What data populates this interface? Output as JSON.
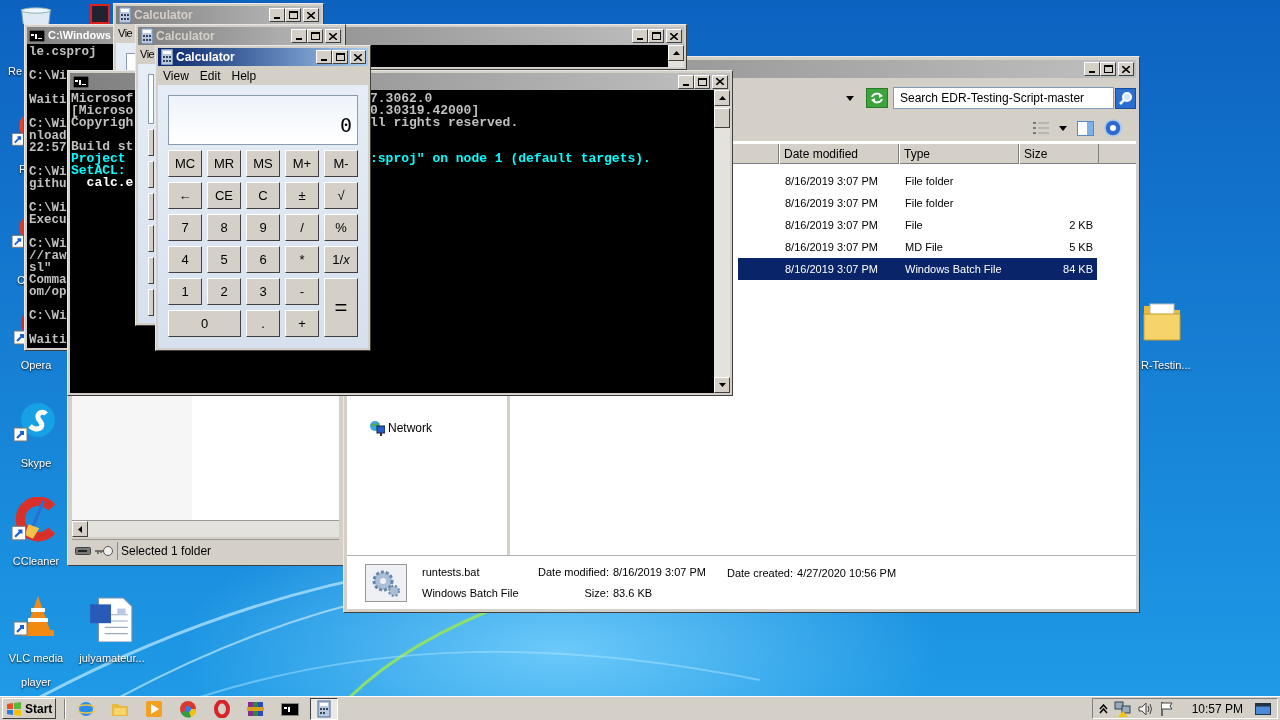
{
  "desktop_icons": [
    {
      "kind": "recycle",
      "label": "Re"
    },
    {
      "kind": "firefox",
      "label": "F"
    },
    {
      "kind": "chrome",
      "label": "C"
    },
    {
      "kind": "opera",
      "label": "Opera"
    },
    {
      "kind": "skype",
      "label": "Skype"
    },
    {
      "kind": "ccleaner",
      "label": "CCleaner"
    },
    {
      "kind": "vlc",
      "label": "VLC media player"
    },
    {
      "kind": "word",
      "label": "julyamateur..."
    },
    {
      "kind": "folder",
      "label": "R-Testin..."
    },
    {
      "kind": "app"
    }
  ],
  "explorer": {
    "search": {
      "placeholder": "Search EDR-Testing-Script-master"
    },
    "columns": [
      "Date modified",
      "Type",
      "Size"
    ],
    "rows": [
      {
        "date": "8/16/2019 3:07 PM",
        "type": "File folder",
        "size": "",
        "selected": false
      },
      {
        "date": "8/16/2019 3:07 PM",
        "type": "File folder",
        "selected": false
      },
      {
        "date": "8/16/2019 3:07 PM",
        "type": "File",
        "size": "2 KB",
        "selected": false
      },
      {
        "date": "8/16/2019 3:07 PM",
        "type": "MD File",
        "size": "5 KB",
        "selected": false
      },
      {
        "date": "8/16/2019 3:07 PM",
        "type": "Windows Batch File",
        "size": "84 KB",
        "selected": true
      }
    ],
    "nav": [
      "Network"
    ],
    "details": {
      "name": "runtests.bat",
      "type": "Windows Batch File",
      "fields": [
        {
          "label": "Date modified:",
          "value": "8/16/2019 3:07 PM"
        },
        {
          "label": "Size:",
          "value": "83.6 KB"
        }
      ],
      "created": {
        "label": "Date created:",
        "value": "4/27/2020 10:56 PM"
      }
    }
  },
  "explorer_back": {
    "status": "Selected 1 folder"
  },
  "cmd_a": {
    "title": "C:\\Windows",
    "blocks": [
      [
        "le.csproj"
      ],
      [
        "C:\\Wi"
      ],
      [
        "Waiti"
      ],
      [
        "C:\\Wi",
        "nload",
        "22:57"
      ],
      [
        "C:\\Wi",
        "githu"
      ],
      [
        "C:\\Wi",
        "Execu"
      ],
      [
        "C:\\Wi",
        "//raw",
        "sl\"",
        "Comma",
        "om/op"
      ],
      [
        "C:\\Wi"
      ],
      [
        "Waiti"
      ]
    ]
  },
  "cmd_c": {
    "blocks": [
      [
        {
          "text": "Microsof",
          "tail": "7.3062.0",
          "color": "#c0c0c0"
        },
        {
          "text": "[Microso",
          "tail": "0.30319.42000]",
          "color": "#c0c0c0"
        },
        {
          "text": "Copyrigh",
          "tail": "ll rights reserved.",
          "color": "#c0c0c0"
        }
      ],
      [
        {
          "text": "Build st",
          "color": "#c0c0c0"
        },
        {
          "text": "Project",
          "tail": ":sproj\" on node 1 (default targets).",
          "color": "#00ffff"
        },
        {
          "text": "SetACL:",
          "color": "#00ffff"
        },
        {
          "text": "  calc.e",
          "color": "#ffffff"
        }
      ]
    ]
  },
  "calculators": [
    {
      "title": "Calculator",
      "active": false,
      "menu": [
        "Vie"
      ]
    },
    {
      "title": "Calculator",
      "active": false,
      "menu": [
        "Vie"
      ]
    },
    {
      "title": "Calculator",
      "active": true,
      "menu": [
        "View",
        "Edit",
        "Help"
      ],
      "display": "0",
      "keys": [
        "MC",
        "MR",
        "MS",
        "M+",
        "M-",
        "←",
        "CE",
        "C",
        "±",
        "√",
        "7",
        "8",
        "9",
        "/",
        "%",
        "4",
        "5",
        "6",
        "*",
        "1/*x*",
        "1",
        "2",
        "3",
        "-",
        "=",
        "0",
        ".",
        "+"
      ]
    }
  ],
  "taskbar": {
    "start": "Start",
    "apps": [
      {
        "kind": "ie",
        "active": false
      },
      {
        "kind": "explorer",
        "active": false
      },
      {
        "kind": "media",
        "active": false
      },
      {
        "kind": "chrome",
        "active": false
      },
      {
        "kind": "opera",
        "active": false
      },
      {
        "kind": "winrar",
        "active": false
      },
      {
        "kind": "console",
        "active": false
      },
      {
        "kind": "calculator",
        "active": true
      }
    ],
    "time": "10:57 PM"
  }
}
